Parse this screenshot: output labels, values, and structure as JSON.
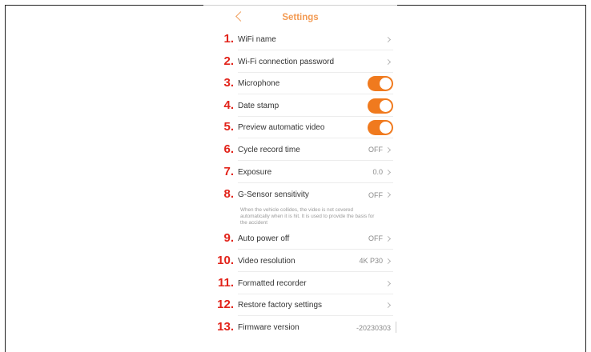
{
  "header": {
    "title": "Settings"
  },
  "settings": [
    {
      "num": "1.",
      "label": "WiFi name",
      "value": ""
    },
    {
      "num": "2.",
      "label": "Wi-Fi connection password",
      "value": ""
    },
    {
      "num": "3.",
      "label": "Microphone",
      "toggle": true
    },
    {
      "num": "4.",
      "label": "Date stamp",
      "toggle": true
    },
    {
      "num": "5.",
      "label": "Preview automatic video",
      "toggle": true
    },
    {
      "num": "6.",
      "label": "Cycle record time",
      "value": "OFF"
    },
    {
      "num": "7.",
      "label": "Exposure",
      "value": "0.0"
    },
    {
      "num": "8.",
      "label": "G-Sensor sensitivity",
      "value": "OFF"
    },
    {
      "num": "9.",
      "label": "Auto power off",
      "value": "OFF"
    },
    {
      "num": "10.",
      "label": "Video resolution",
      "value": "4K P30"
    },
    {
      "num": "11.",
      "label": "Formatted recorder",
      "value": ""
    },
    {
      "num": "12.",
      "label": "Restore factory settings",
      "value": ""
    },
    {
      "num": "13.",
      "label": "Firmware version",
      "value": "-20230303"
    }
  ],
  "gsensor_note": "When the vehicle collides, the video is not covered automatically when it is hit. It is used to provide the basis for the accident",
  "colors": {
    "accent": "#f07a1e",
    "number_red": "#e2231a",
    "title_orange": "#f39a52"
  }
}
